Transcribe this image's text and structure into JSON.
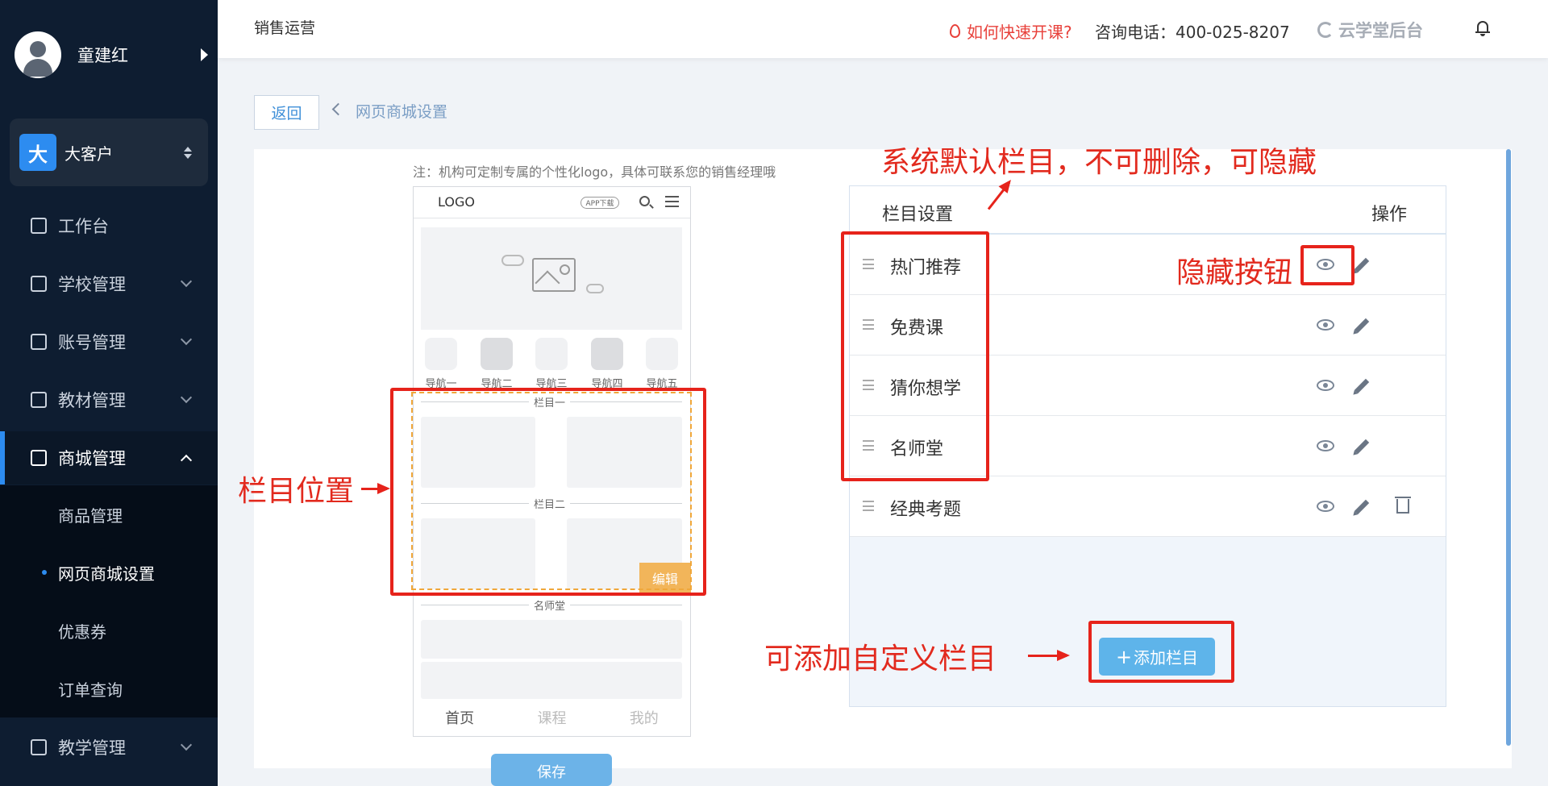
{
  "sidebar": {
    "user_name": "童建红",
    "org_badge": "大",
    "org_name": "大客户",
    "menu": [
      {
        "label": "工作台"
      },
      {
        "label": "学校管理"
      },
      {
        "label": "账号管理"
      },
      {
        "label": "教材管理"
      },
      {
        "label": "商城管理"
      },
      {
        "label": "教学管理"
      }
    ],
    "submenu": [
      {
        "label": "商品管理"
      },
      {
        "label": "网页商城设置"
      },
      {
        "label": "优惠券"
      },
      {
        "label": "订单查询"
      }
    ]
  },
  "header": {
    "title": "销售运营",
    "how_link": "如何快速开课?",
    "phone": "咨询电话：400-025-8207",
    "brand": "云学堂后台"
  },
  "breadcrumb": {
    "back": "返回",
    "current": "网页商城设置"
  },
  "note": "注：机构可定制专属的个性化logo，具体可联系您的销售经理哦",
  "preview": {
    "logo": "LOGO",
    "app_badge": "APP下载",
    "nav": [
      "导航一",
      "导航二",
      "导航三",
      "导航四",
      "导航五"
    ],
    "section1": "栏目一",
    "section2": "栏目二",
    "section3": "名师堂",
    "edit": "编辑",
    "tabs": [
      "首页",
      "课程",
      "我的"
    ],
    "save": "保存"
  },
  "columns_table": {
    "header_title": "栏目设置",
    "header_op": "操作",
    "rows": [
      {
        "name": "热门推荐"
      },
      {
        "name": "免费课"
      },
      {
        "name": "猜你想学"
      },
      {
        "name": "名师堂"
      },
      {
        "name": "经典考题"
      }
    ],
    "add_button": "添加栏目"
  },
  "annotations": {
    "system_default": "系统默认栏目，不可删除，可隐藏",
    "hide_button": "隐藏按钮",
    "column_position": "栏目位置",
    "add_custom": "可添加自定义栏目"
  },
  "colors": {
    "sidebar_bg": "#0e1d31",
    "accent": "#2d8cf0",
    "annotation_red": "#e6231b",
    "edit_orange": "#f2b55a"
  }
}
